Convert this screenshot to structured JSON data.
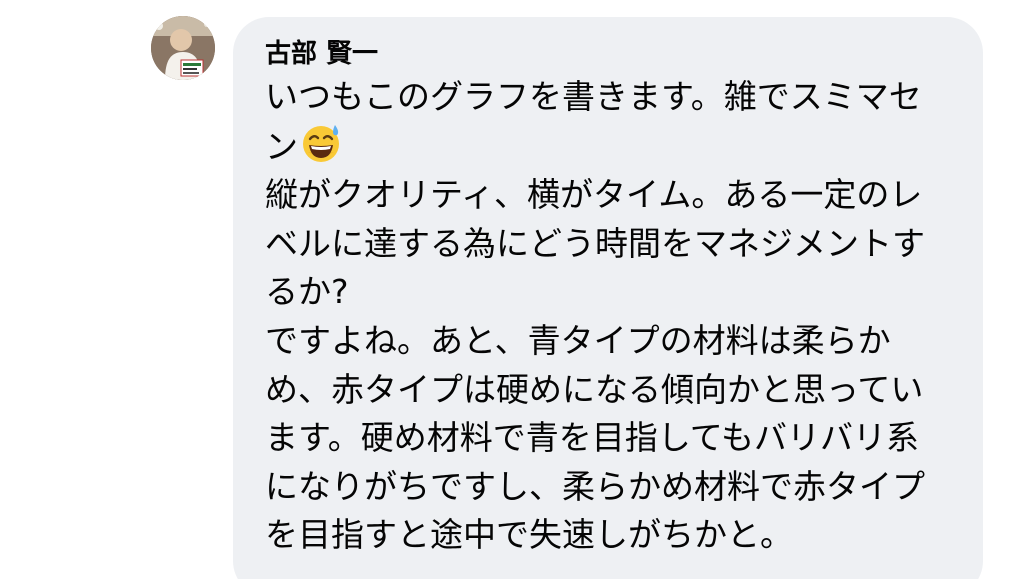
{
  "comment": {
    "author": "古部 賢一",
    "avatar_icon": "user-avatar-photo",
    "lines": [
      "いつもこのグラフを書きます。雑でスミマセ",
      "ン",
      "縦がクオリティ、横がタイム。ある一定のレ",
      "ベルに達する為にどう時間をマネジメントす",
      "るか?",
      "ですよね。あと、青タイプの材料は柔らか",
      "め、赤タイプは硬めになる傾向かと思ってい",
      "ます。硬め材料で青を目指してもバリバリ系",
      "になりがちですし、柔らかめ材料で赤タイプ",
      "を目指すと途中で失速しがちかと。"
    ],
    "emoji_icon": "grinning-face-with-sweat-icon"
  },
  "colors": {
    "bubble_background": "#eef0f3",
    "text": "#050505"
  }
}
